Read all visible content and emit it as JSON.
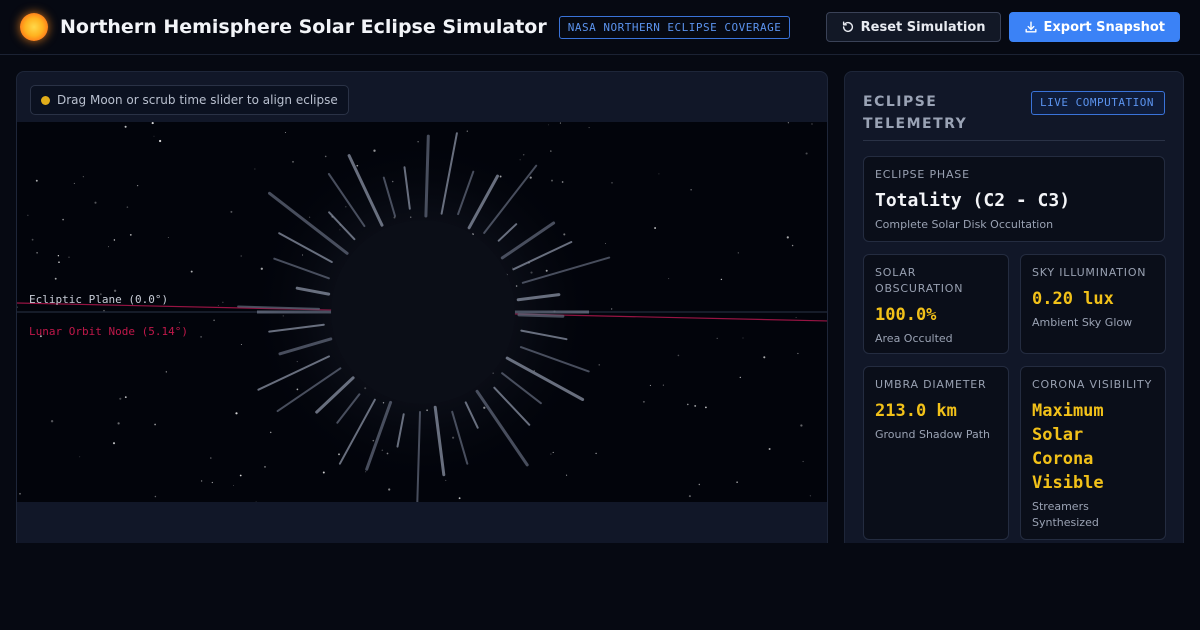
{
  "header": {
    "title": "Northern Hemisphere Solar Eclipse Simulator",
    "badge": "NASA NORTHERN ECLIPSE COVERAGE",
    "reset_label": "Reset Simulation",
    "export_label": "Export Snapshot"
  },
  "simulation": {
    "hint": "Drag Moon or scrub time slider to align eclipse",
    "ecliptic_label": "Ecliptic Plane (0.0°)",
    "node_label": "Lunar Orbit Node (5.14°)"
  },
  "telemetry": {
    "title": "ECLIPSE TELEMETRY",
    "status_badge": "LIVE COMPUTATION",
    "phase": {
      "label": "ECLIPSE PHASE",
      "value": "Totality (C2 - C3)",
      "sub": "Complete Solar Disk Occultation"
    },
    "obscuration": {
      "label": "SOLAR OBSCURATION",
      "value": "100.0%",
      "sub": "Area Occulted"
    },
    "illumination": {
      "label": "SKY ILLUMINATION",
      "value": "0.20 lux",
      "sub": "Ambient Sky Glow"
    },
    "umbra": {
      "label": "UMBRA DIAMETER",
      "value": "213.0 km",
      "sub": "Ground Shadow Path"
    },
    "corona": {
      "label": "CORONA VISIBILITY",
      "value": "Maximum Solar Corona Visible",
      "sub": "Streamers Synthesized"
    }
  },
  "colors": {
    "accent": "#3b82f6",
    "value_gold": "#f2c119",
    "node_line": "#c0184a",
    "background": "#060912"
  }
}
